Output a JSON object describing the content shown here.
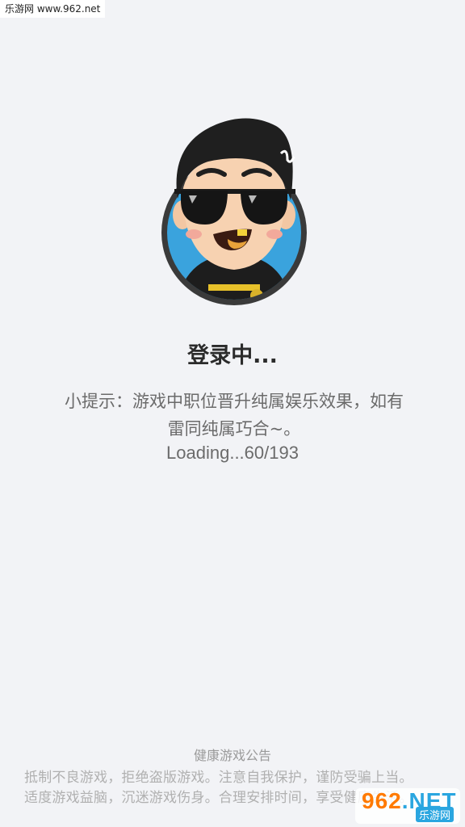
{
  "watermark_top": "乐游网 www.962.net",
  "login": {
    "title": "登录中...",
    "tip_line1": "小提示：游戏中职位晋升纯属娱乐效果，如有",
    "tip_line2": "雷同纯属巧合~。",
    "loading": "Loading...60/193"
  },
  "health_notice": {
    "title": "健康游戏公告",
    "line1": "抵制不良游戏，拒绝盗版游戏。注意自我保护，谨防受骗上当。",
    "line2": "适度游戏益脑，沉迷游戏伤身。合理安排时间，享受健康生活。"
  },
  "logo_watermark": {
    "top_number": "962",
    "top_suffix": ".NET",
    "bottom": "乐游网"
  },
  "colors": {
    "background": "#f2f3f6",
    "avatar_ring": "#3a3a3a",
    "avatar_bg": "#3aa3dd"
  }
}
